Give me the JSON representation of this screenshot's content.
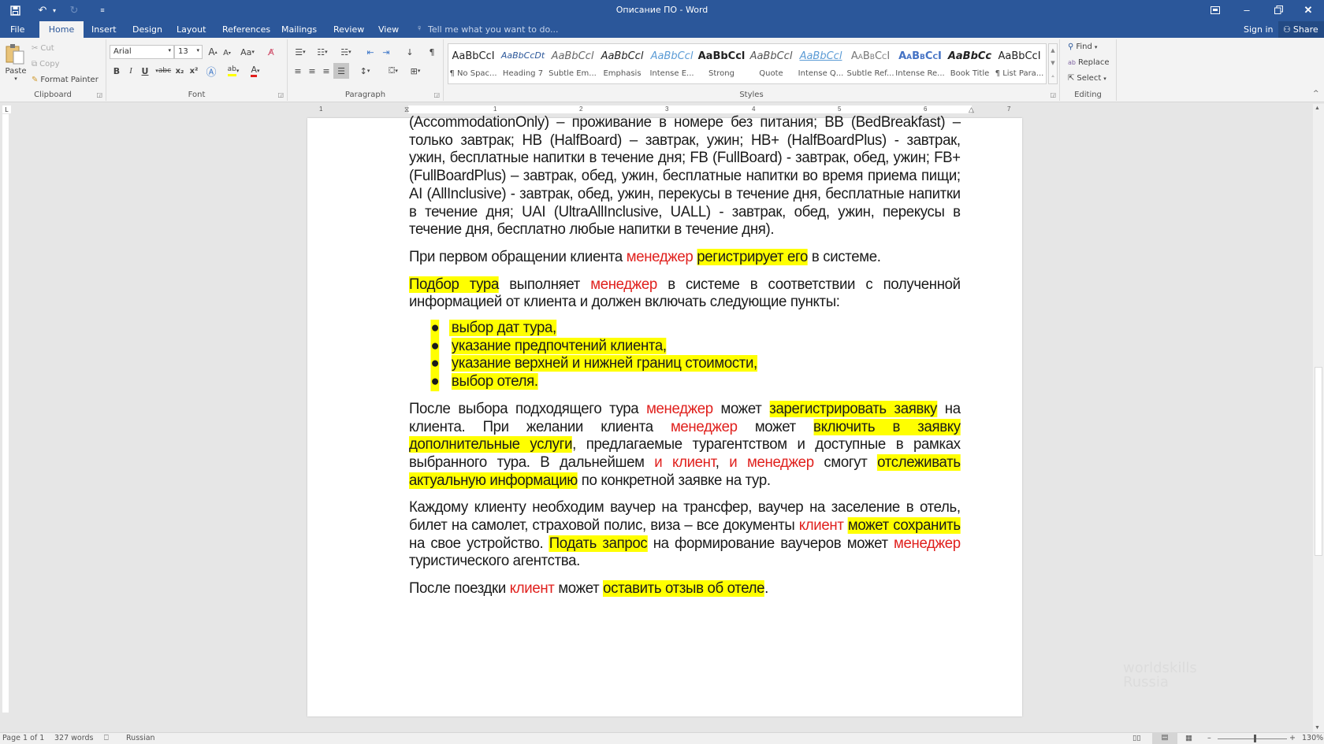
{
  "window": {
    "title": "Описание ПО - Word",
    "controls": {
      "ribbon_display": "ribbon-display-icon",
      "minimize": "minimize-icon",
      "restore": "restore-icon",
      "close": "close-icon"
    }
  },
  "quick_access": {
    "save": "save-icon",
    "undo": "undo-icon",
    "redo": "redo-icon",
    "customize": "customize-icon"
  },
  "tabs": [
    {
      "label": "File"
    },
    {
      "label": "Home",
      "active": true
    },
    {
      "label": "Insert"
    },
    {
      "label": "Design"
    },
    {
      "label": "Layout"
    },
    {
      "label": "References"
    },
    {
      "label": "Mailings"
    },
    {
      "label": "Review"
    },
    {
      "label": "View"
    }
  ],
  "tell_me": "Tell me what you want to do...",
  "account": {
    "sign_in": "Sign in",
    "share": "Share"
  },
  "ribbon": {
    "clipboard": {
      "label": "Clipboard",
      "paste": "Paste",
      "cut": "Cut",
      "copy": "Copy",
      "format_painter": "Format Painter"
    },
    "font": {
      "label": "Font",
      "font_name": "Arial",
      "font_size": "13",
      "bold": "B",
      "italic": "I",
      "underline": "U",
      "strikethrough": "abc",
      "subscript": "x₂",
      "superscript": "x²",
      "change_case": "Aa",
      "grow": "A",
      "shrink": "A"
    },
    "paragraph": {
      "label": "Paragraph",
      "pilcrow": "¶"
    },
    "styles": {
      "label": "Styles",
      "items": [
        {
          "preview": "AaBbCcI",
          "name": "¶ No Spac..."
        },
        {
          "preview": "AaBbCcDt",
          "name": "Heading 7"
        },
        {
          "preview": "AaBbCcl",
          "name": "Subtle Em..."
        },
        {
          "preview": "AaBbCcl",
          "name": "Emphasis"
        },
        {
          "preview": "AaBbCcl",
          "name": "Intense E..."
        },
        {
          "preview": "AaBbCcl",
          "name": "Strong"
        },
        {
          "preview": "AaBbCcl",
          "name": "Quote"
        },
        {
          "preview": "AaBbCcl",
          "name": "Intense Q..."
        },
        {
          "preview": "AaBbCcI",
          "name": "Subtle Ref..."
        },
        {
          "preview": "AaBbCcI",
          "name": "Intense Re..."
        },
        {
          "preview": "AaBbCc",
          "name": "Book Title"
        },
        {
          "preview": "AaBbCcI",
          "name": "¶ List Para..."
        }
      ]
    },
    "editing": {
      "label": "Editing",
      "find": "Find",
      "replace": "Replace",
      "select": "Select"
    }
  },
  "ruler": {
    "ticks": [
      "1",
      "1",
      "2",
      "3",
      "4",
      "5",
      "6",
      "7"
    ]
  },
  "document": {
    "p1": "(AccommodationOnly) – проживание в номере без питания; BB (BedBreakfast) – только завтрак; HB (HalfBoard) – завтрак, ужин; HB+ (HalfBoardPlus) - завтрак, ужин, бесплатные напитки в течение дня; FB (FullBoard) - завтрак, обед, ужин; FB+ (FullBoardPlus) – завтрак, обед, ужин, бесплатные напитки во время приема пищи; AI (AllInclusive) - завтрак, обед, ужин, перекусы в течение дня, бесплатные напитки в течение дня; UAI (UltraAllInclusive, UALL) - завтрак, обед, ужин, перекусы в течение дня, бесплатно любые напитки в течение дня).",
    "p2": {
      "a": "При первом обращении клиента ",
      "b": "менеджер",
      "c": " ",
      "d": "регистрирует его",
      "e": " в системе."
    },
    "p3": {
      "a": "Подбор тура",
      "b": " выполняет ",
      "c": "менеджер",
      "d": " в системе в соответствии с полученной информацией от клиента и должен включать следующие пункты:"
    },
    "list": [
      "выбор дат тура,",
      "указание предпочтений клиента,",
      "указание верхней и нижней границ стоимости,",
      "выбор отеля."
    ],
    "bullet": "●",
    "p4": {
      "a": "После выбора подходящего тура ",
      "b": "менеджер",
      "c": " может ",
      "d": "зарегистрировать заявку",
      "e": " на клиента. При желании клиента ",
      "f": "менеджер",
      "g": " может ",
      "h": "включить в заявку дополнительные услуги",
      "i": ", предлагаемые турагентством и доступные в рамках выбранного тура. В дальнейшем ",
      "j": "и клиент",
      "k": ", ",
      "l": "и менеджер",
      "m": " смогут ",
      "n": "отслеживать актуальную информацию",
      "o": " по конкретной заявке на тур."
    },
    "p5": {
      "a": "Каждому клиенту необходим ваучер на трансфер, ваучер на заселение в отель, билет на самолет, страховой полис, виза – все документы ",
      "b": "клиент",
      "c": " ",
      "d": "может сохранить",
      "e": " на свое устройство. ",
      "f": "Подать запрос",
      "g": " на формирование ваучеров может ",
      "h": "менеджер",
      "i": " туристического агентства."
    },
    "p6": {
      "a": "После поездки ",
      "b": "клиент",
      "c": " может ",
      "d": "оставить отзыв об отеле",
      "e": "."
    }
  },
  "status": {
    "page": "Page 1 of 1",
    "words": "327 words",
    "language": "Russian",
    "zoom": "130%",
    "zoom_percent": 130
  },
  "watermark": {
    "line1": "worldskills",
    "line2": "Russia"
  },
  "colors": {
    "brand": "#2b579a",
    "highlight": "#ffff00",
    "actor_red": "#e0201d"
  }
}
